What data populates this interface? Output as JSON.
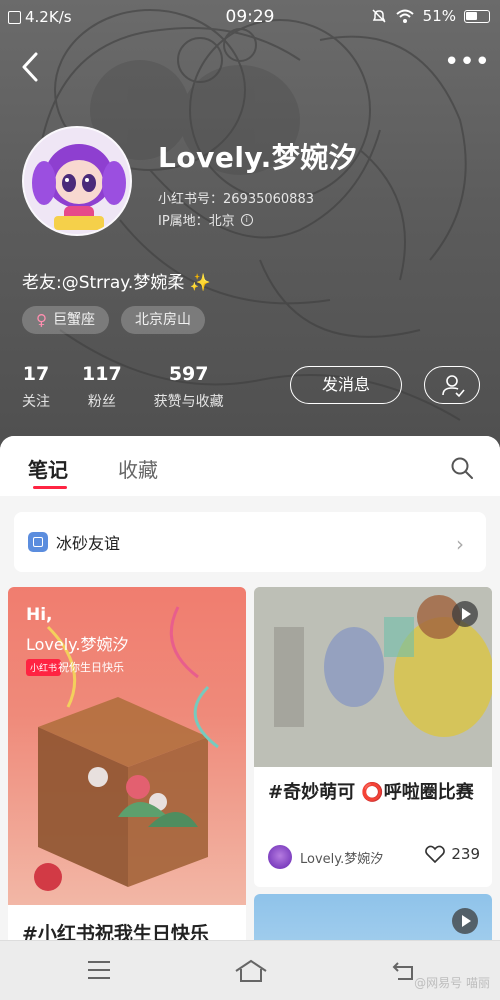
{
  "status_bar": {
    "net_speed": "4.2K/s",
    "time": "09:29",
    "battery": "51%"
  },
  "profile": {
    "name": "Lovely.梦婉汐",
    "xhs_id": "小红书号：26935060883",
    "ip_location": "IP属地：北京",
    "bio": "老友:@Strray.梦婉柔 ✨",
    "tags": [
      "巨蟹座",
      "北京房山"
    ],
    "stats": [
      {
        "num": "17",
        "label": "关注"
      },
      {
        "num": "117",
        "label": "粉丝"
      },
      {
        "num": "597",
        "label": "获赞与收藏"
      }
    ],
    "message_button": "发消息"
  },
  "tabs": {
    "notes": "笔记",
    "collect": "收藏"
  },
  "album": {
    "title": "冰砂友谊"
  },
  "cards": [
    {
      "hi": "Hi,",
      "name": "Lovely.梦婉汐",
      "badge": "小红书",
      "wish": "祝你生日快乐",
      "caption": "#小红书祝我生日快乐"
    },
    {
      "caption": "#奇妙萌可 ⭕呼啦圈比赛",
      "author": "Lovely.梦婉汐",
      "likes": "239"
    }
  ],
  "watermark": "@网易号 喵丽",
  "colors": {
    "accent": "#ff2442",
    "header_bg": "#5c5c5c"
  }
}
